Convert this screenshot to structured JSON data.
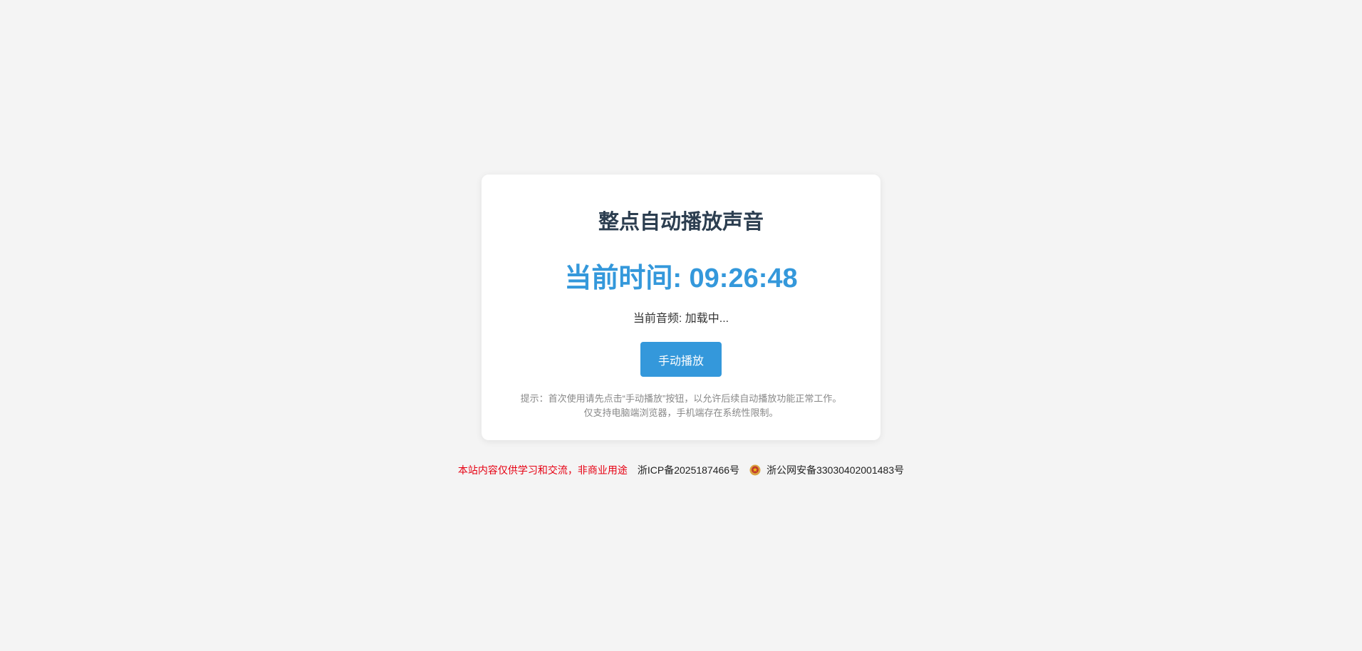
{
  "main": {
    "title": "整点自动播放声音",
    "clock_label": "当前时间: 09:26:48",
    "audio_status": "当前音频: 加载中...",
    "play_button": "手动播放",
    "hint_line1": "提示：首次使用请先点击“手动播放”按钮，以允许后续自动播放功能正常工作。",
    "hint_line2": "仅支持电脑端浏览器，手机端存在系统性限制。"
  },
  "footer": {
    "disclaimer": "本站内容仅供学习和交流，非商业用途",
    "icp": "浙ICP备2025187466号",
    "police_record": "浙公网安备33030402001483号",
    "police_icon": "police-badge-icon"
  },
  "colors": {
    "accent": "#3498db",
    "title": "#2c3e50",
    "disclaimer": "#e60012",
    "background": "#f4f4f4"
  }
}
